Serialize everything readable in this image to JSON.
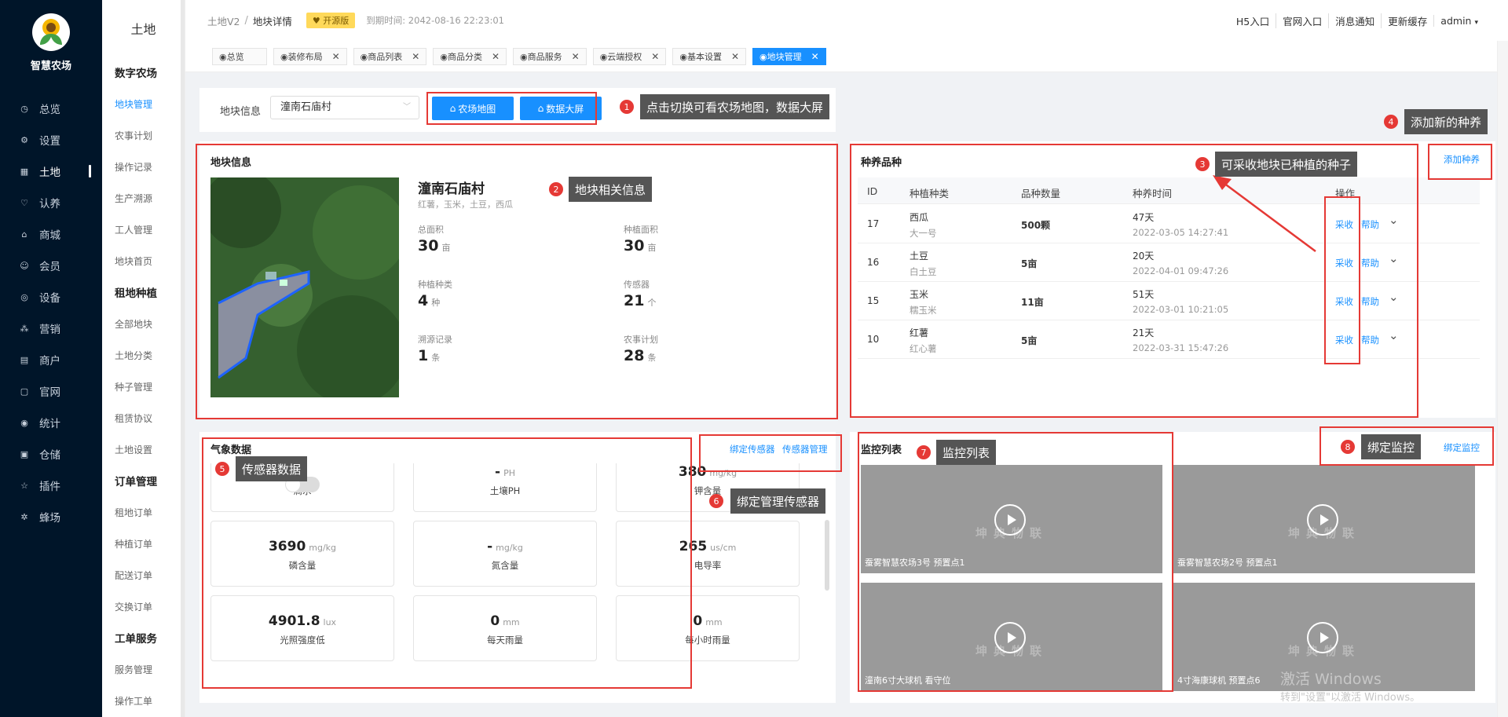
{
  "brand": {
    "name": "智慧农场"
  },
  "nav": [
    {
      "label": "总览",
      "icon": "dashboard-icon"
    },
    {
      "label": "设置",
      "icon": "gear-icon"
    },
    {
      "label": "土地",
      "icon": "grid-icon"
    },
    {
      "label": "认养",
      "icon": "heart-icon"
    },
    {
      "label": "商城",
      "icon": "shop-icon"
    },
    {
      "label": "会员",
      "icon": "user-icon"
    },
    {
      "label": "设备",
      "icon": "device-icon"
    },
    {
      "label": "营销",
      "icon": "marketing-icon"
    },
    {
      "label": "商户",
      "icon": "merchant-icon"
    },
    {
      "label": "官网",
      "icon": "website-icon"
    },
    {
      "label": "统计",
      "icon": "chart-icon"
    },
    {
      "label": "仓储",
      "icon": "warehouse-icon"
    },
    {
      "label": "插件",
      "icon": "star-icon"
    },
    {
      "label": "蜂场",
      "icon": "bee-icon"
    }
  ],
  "subnav": {
    "title": "土地",
    "groups": [
      {
        "title": "数字农场",
        "items": [
          "地块管理",
          "农事计划",
          "操作记录",
          "生产溯源",
          "工人管理",
          "地块首页"
        ]
      },
      {
        "title": "租地种植",
        "items": [
          "全部地块",
          "土地分类",
          "种子管理",
          "租赁协议",
          "土地设置"
        ]
      },
      {
        "title": "订单管理",
        "items": [
          "租地订单",
          "种植订单",
          "配送订单",
          "交换订单"
        ]
      },
      {
        "title": "工单服务",
        "items": [
          "服务管理",
          "操作工单"
        ]
      }
    ]
  },
  "header": {
    "crumb_root": "土地V2",
    "crumb_sep": "/",
    "crumb_current": "地块详情",
    "badge": "开源版",
    "expire": "到期时间: 2042-08-16 22:23:01",
    "links": [
      "H5入口",
      "官网入口",
      "消息通知",
      "更新缓存",
      "admin"
    ]
  },
  "tabs": [
    {
      "label": "◉总览",
      "closable": false
    },
    {
      "label": "◉装修布局",
      "closable": true
    },
    {
      "label": "◉商品列表",
      "closable": true
    },
    {
      "label": "◉商品分类",
      "closable": true
    },
    {
      "label": "◉商品服务",
      "closable": true
    },
    {
      "label": "◉云端授权",
      "closable": true
    },
    {
      "label": "◉基本设置",
      "closable": true
    },
    {
      "label": "◉地块管理",
      "closable": true,
      "active": true
    }
  ],
  "filter": {
    "label": "地块信息",
    "selected": "潼南石庙村",
    "btn_map": "农场地图",
    "btn_screen": "数据大屏"
  },
  "land": {
    "title": "地块信息",
    "name": "潼南石庙村",
    "crops": "红薯，玉米，土豆，西瓜",
    "stats": [
      {
        "label": "总面积",
        "value": "30",
        "unit": "亩"
      },
      {
        "label": "种植面积",
        "value": "30",
        "unit": "亩"
      },
      {
        "label": "种植种类",
        "value": "4",
        "unit": "种"
      },
      {
        "label": "传感器",
        "value": "21",
        "unit": "个"
      },
      {
        "label": "溯源记录",
        "value": "1",
        "unit": "条"
      },
      {
        "label": "农事计划",
        "value": "28",
        "unit": "条"
      }
    ]
  },
  "breeds": {
    "title": "种养品种",
    "add_link": "添加种养",
    "headers": [
      "ID",
      "种植种类",
      "品种数量",
      "种养时间",
      "操作"
    ],
    "rows": [
      {
        "id": "17",
        "name": "西瓜",
        "variety": "大一号",
        "qty": "500颗",
        "days": "47天",
        "time": "2022-03-05 14:27:41"
      },
      {
        "id": "16",
        "name": "土豆",
        "variety": "白土豆",
        "qty": "5亩",
        "days": "20天",
        "time": "2022-04-01 09:47:26"
      },
      {
        "id": "15",
        "name": "玉米",
        "variety": "糯玉米",
        "qty": "11亩",
        "days": "51天",
        "time": "2022-03-01 10:21:05"
      },
      {
        "id": "10",
        "name": "红薯",
        "variety": "红心薯",
        "qty": "5亩",
        "days": "21天",
        "time": "2022-03-31 15:47:26"
      }
    ],
    "action_harvest": "采收",
    "action_help": "帮助"
  },
  "weather": {
    "title": "气象数据",
    "link_bind": "绑定传感器",
    "link_manage": "传感器管理",
    "cards": [
      {
        "value": "",
        "unit": "",
        "name": "滴水"
      },
      {
        "value": "-",
        "unit": "PH",
        "name": "土壤PH"
      },
      {
        "value": "380",
        "unit": "mg/kg",
        "name": "钾含量"
      },
      {
        "value": "3690",
        "unit": "mg/kg",
        "name": "磷含量"
      },
      {
        "value": "-",
        "unit": "mg/kg",
        "name": "氮含量"
      },
      {
        "value": "265",
        "unit": "us/cm",
        "name": "电导率"
      },
      {
        "value": "4901.8",
        "unit": "lux",
        "name": "光照强度低"
      },
      {
        "value": "0",
        "unit": "mm",
        "name": "每天雨量"
      },
      {
        "value": "0",
        "unit": "mm",
        "name": "每小时雨量"
      }
    ]
  },
  "monitor": {
    "title": "监控列表",
    "link_bind": "绑定监控",
    "watermark": "坤典物联",
    "videos": [
      {
        "caption": "蚕雾智慧农场3号 预置点1"
      },
      {
        "caption": "蚕雾智慧农场2号 预置点1"
      },
      {
        "caption": "潼南6寸大球机 看守位"
      },
      {
        "caption": "4寸海康球机 预置点6"
      }
    ]
  },
  "annotations": [
    {
      "num": "1",
      "text": "点击切换可看农场地图，数据大屏"
    },
    {
      "num": "2",
      "text": "地块相关信息"
    },
    {
      "num": "3",
      "text": "可采收地块已种植的种子"
    },
    {
      "num": "4",
      "text": "添加新的种养"
    },
    {
      "num": "5",
      "text": "传感器数据"
    },
    {
      "num": "6",
      "text": "绑定管理传感器"
    },
    {
      "num": "7",
      "text": "监控列表"
    },
    {
      "num": "8",
      "text": "绑定监控"
    }
  ],
  "os_notice": {
    "line1": "激活 Windows",
    "line2": "转到\"设置\"以激活 Windows。"
  },
  "colors": {
    "sidebar": "#001529",
    "accent": "#1890ff",
    "annotation": "#e53935",
    "badge": "#ffd95a"
  }
}
